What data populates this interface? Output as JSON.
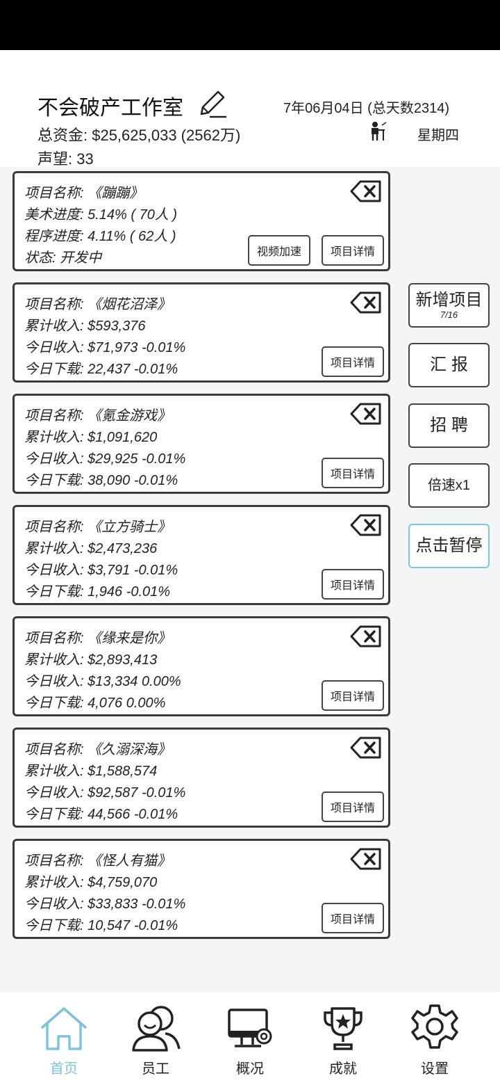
{
  "header": {
    "studio_name": "不会破产工作室",
    "date": "7年06月04日 (总天数2314)",
    "funds": "总资金: $25,625,033 (2562万)",
    "weekday": "星期四",
    "fame": "声望: 33",
    "icons": [
      "pencil-icon",
      "worker-desk-icon"
    ]
  },
  "projects": [
    {
      "line1": "项目名称: 《蹦蹦》",
      "line2": "美术进度: 5.14% ( 70人 )",
      "line3": "程序进度: 4.11% ( 62人 )",
      "line4": "状态: 开发中",
      "speed_button": "视频加速",
      "detail_button": "项目详情"
    },
    {
      "line1": "项目名称: 《烟花沼泽》",
      "line2": "累计收入: $593,376",
      "line3": "今日收入: $71,973   -0.01%",
      "line4": "今日下载: 22,437   -0.01%",
      "detail_button": "项目详情"
    },
    {
      "line1": "项目名称: 《氪金游戏》",
      "line2": "累计收入: $1,091,620",
      "line3": "今日收入: $29,925   -0.01%",
      "line4": "今日下载: 38,090   -0.01%",
      "detail_button": "项目详情"
    },
    {
      "line1": "项目名称: 《立方骑士》",
      "line2": "累计收入: $2,473,236",
      "line3": "今日收入: $3,791   -0.01%",
      "line4": "今日下载: 1,946   -0.01%",
      "detail_button": "项目详情"
    },
    {
      "line1": "项目名称: 《缘来是你》",
      "line2": "累计收入: $2,893,413",
      "line3": "今日收入: $13,334   0.00%",
      "line4": "今日下载: 4,076   0.00%",
      "detail_button": "项目详情"
    },
    {
      "line1": "项目名称: 《久溺深海》",
      "line2": "累计收入: $1,588,574",
      "line3": "今日收入: $92,587   -0.01%",
      "line4": "今日下载: 44,566   -0.01%",
      "detail_button": "项目详情"
    },
    {
      "line1": "项目名称: 《怪人有猫》",
      "line2": "累计收入: $4,759,070",
      "line3": "今日收入: $33,833   -0.01%",
      "line4": "今日下载: 10,547   -0.01%",
      "detail_button": "项目详情"
    }
  ],
  "side_buttons": {
    "new_project": "新增项目",
    "project_count": "7/16",
    "report": "汇  报",
    "recruit": "招  聘",
    "speed": "倍速x1",
    "pause": "点击暂停"
  },
  "nav": {
    "home": "首页",
    "staff": "员工",
    "overview": "概况",
    "achievements": "成就",
    "settings": "设置",
    "active": "home",
    "active_color": "#7cc5da"
  },
  "colors": {
    "background": "#f4f5f7",
    "accent": "#7cc5da",
    "border": "#3a3a3a"
  }
}
